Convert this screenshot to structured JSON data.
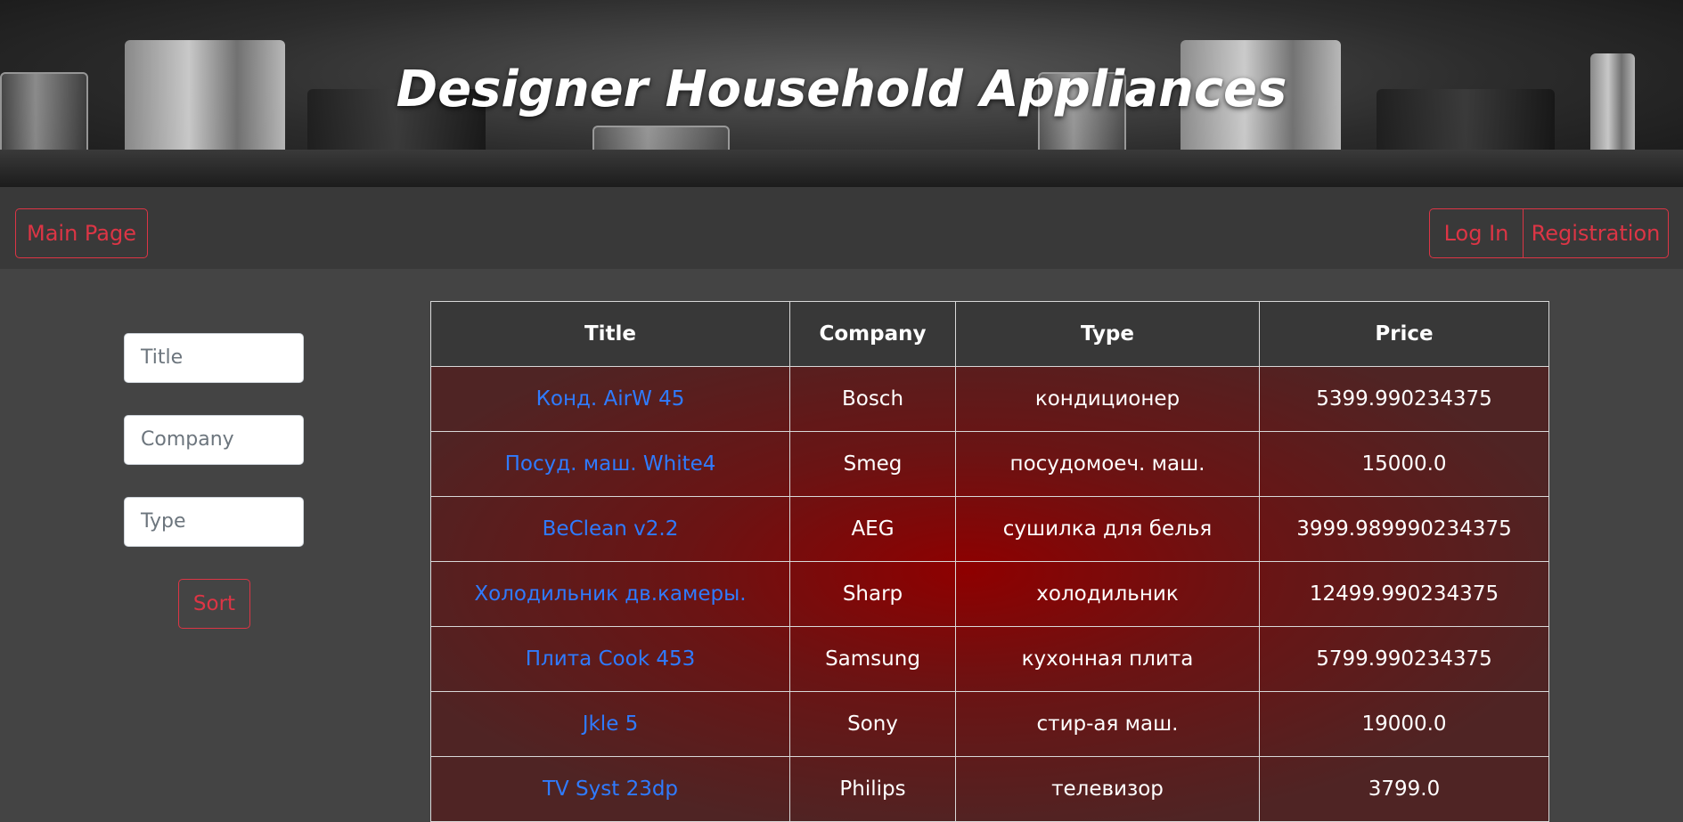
{
  "banner": {
    "title": "Designer Household Appliances"
  },
  "nav": {
    "main_page": "Main Page",
    "log_in": "Log In",
    "registration": "Registration"
  },
  "filters": {
    "title_placeholder": "Title",
    "company_placeholder": "Company",
    "type_placeholder": "Type",
    "sort_label": "Sort"
  },
  "table": {
    "headers": [
      "Title",
      "Company",
      "Type",
      "Price"
    ],
    "rows": [
      [
        "Конд. AirW 45",
        "Bosch",
        "кондиционер",
        "5399.990234375"
      ],
      [
        "Посуд. маш. White4",
        "Smeg",
        "посудомоеч. маш.",
        "15000.0"
      ],
      [
        "BeClean v2.2",
        "AEG",
        "сушилка для белья",
        "3999.989990234375"
      ],
      [
        "Холодильник дв.камеры.",
        "Sharp",
        "холодильник",
        "12499.990234375"
      ],
      [
        "Плита Cook 453",
        "Samsung",
        "кухонная плита",
        "5799.990234375"
      ],
      [
        "Jkle 5",
        "Sony",
        "стир-ая маш.",
        "19000.0"
      ],
      [
        "TV Syst 23dp",
        "Philips",
        "телевизор",
        "3799.0"
      ]
    ]
  },
  "colors": {
    "accent": "#dc3545",
    "link": "#2f7bff",
    "page_bg": "#444444",
    "navbar_bg": "#393939",
    "table_row_bg": "#6a1414"
  }
}
